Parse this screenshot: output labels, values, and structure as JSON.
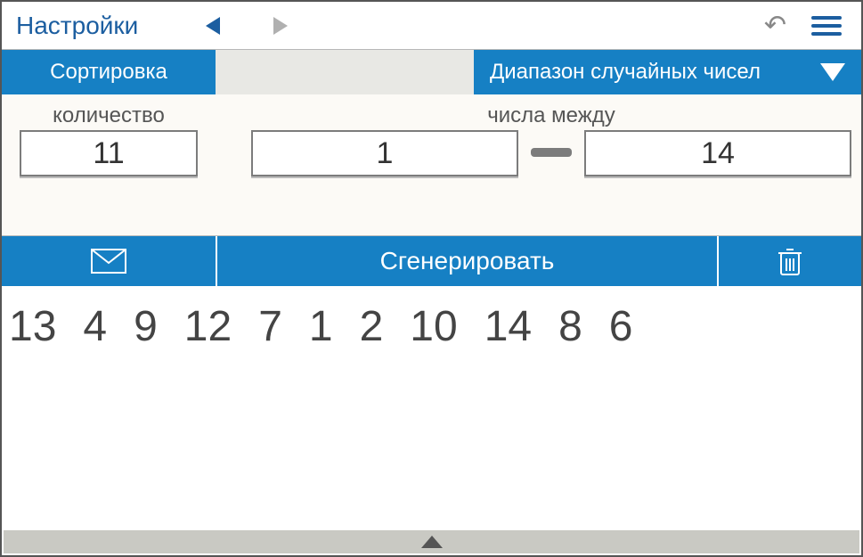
{
  "topbar": {
    "settings_label": "Настройки"
  },
  "tabs": {
    "sort_label": "Сортировка",
    "range_label": "Диапазон случайных чисел"
  },
  "inputs": {
    "count_label": "количество",
    "count_value": "11",
    "between_label": "числа между",
    "from_value": "1",
    "to_value": "14"
  },
  "actions": {
    "generate_label": "Сгенерировать"
  },
  "results": [
    "13",
    "4",
    "9",
    "12",
    "7",
    "1",
    "2",
    "10",
    "14",
    "8",
    "6"
  ]
}
